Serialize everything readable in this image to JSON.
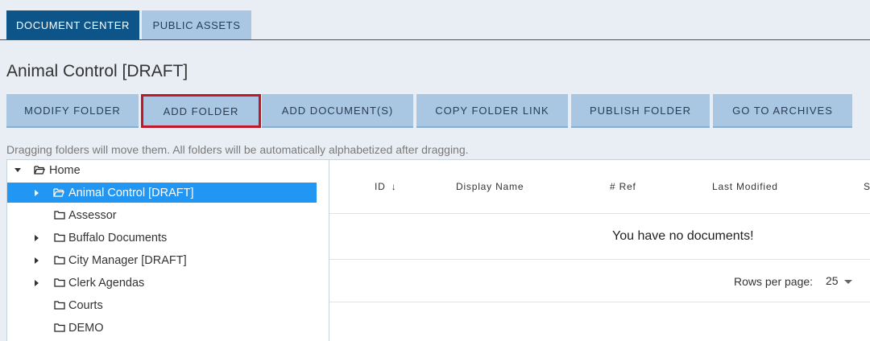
{
  "tabs": {
    "document_center": "DOCUMENT CENTER",
    "public_assets": "PUBLIC ASSETS"
  },
  "page_title": "Animal Control [DRAFT]",
  "toolbar": {
    "modify_folder": "MODIFY FOLDER",
    "add_folder": "ADD FOLDER",
    "add_documents": "ADD DOCUMENT(S)",
    "copy_folder_link": "COPY FOLDER LINK",
    "publish_folder": "PUBLISH FOLDER",
    "go_to_archives": "GO TO ARCHIVES"
  },
  "hint": "Dragging folders will move them. All folders will be automatically alphabetized after dragging.",
  "tree": {
    "root": "Home",
    "items": [
      {
        "label": "Animal Control [DRAFT]",
        "expandable": true,
        "selected": true
      },
      {
        "label": "Assessor",
        "expandable": false,
        "selected": false
      },
      {
        "label": "Buffalo Documents",
        "expandable": true,
        "selected": false
      },
      {
        "label": "City Manager [DRAFT]",
        "expandable": true,
        "selected": false
      },
      {
        "label": "Clerk Agendas",
        "expandable": true,
        "selected": false
      },
      {
        "label": "Courts",
        "expandable": false,
        "selected": false
      },
      {
        "label": "DEMO",
        "expandable": false,
        "selected": false
      }
    ]
  },
  "table": {
    "columns": {
      "id": "ID",
      "sort_indicator": "↓",
      "display_name": "Display Name",
      "ref": "# Ref",
      "last_modified": "Last Modified",
      "truncated": "S"
    },
    "empty_message": "You have no documents!",
    "rows_per_page_label": "Rows per page:",
    "rows_per_page_value": "25"
  },
  "colors": {
    "active_tab": "#0d5489",
    "inactive_tab": "#a9c6e3",
    "button": "#a9c6e3",
    "highlight_border": "#c0182b",
    "selected_row": "#2196f3"
  }
}
